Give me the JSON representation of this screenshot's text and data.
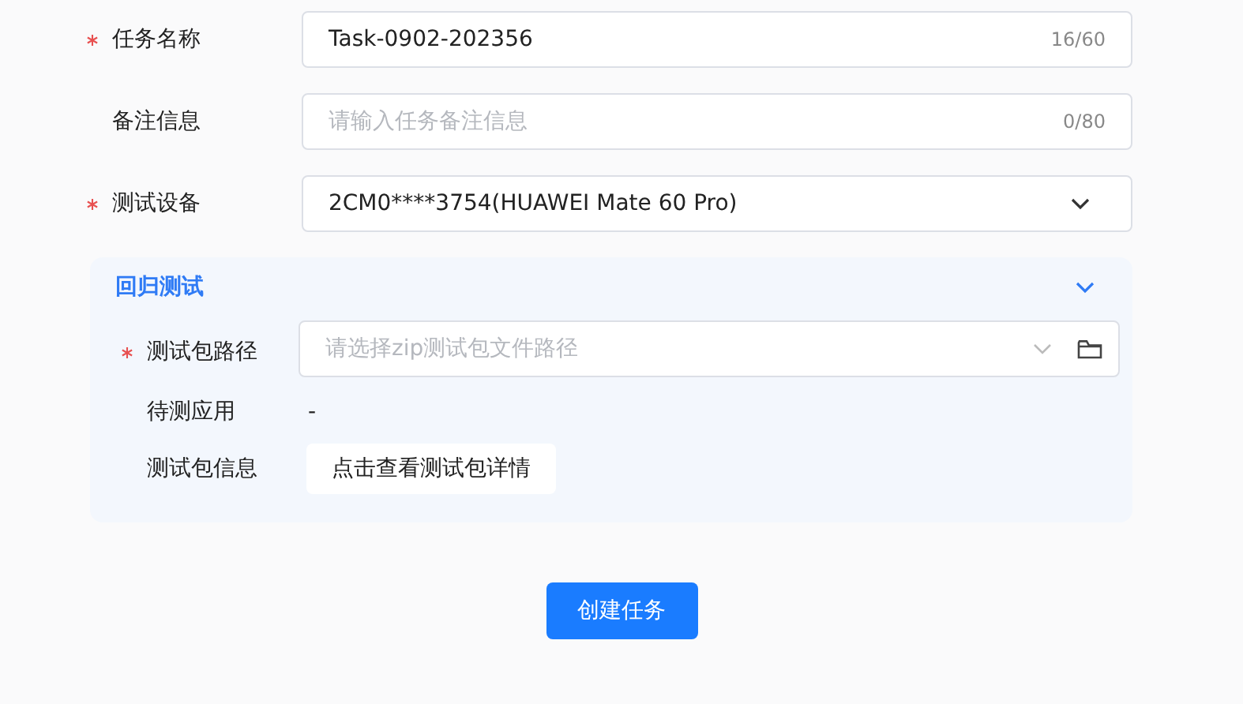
{
  "fields": [
    {
      "kind": "text",
      "label": "任务名称",
      "required": true,
      "value": "Task-0902-202356",
      "counter": "16/60"
    },
    {
      "kind": "text",
      "label": "备注信息",
      "required": false,
      "placeholder": "请输入任务备注信息",
      "counter": "0/80"
    },
    {
      "kind": "select",
      "label": "测试设备",
      "required": true,
      "value": "2CM0****3754(HUAWEI Mate 60 Pro)"
    }
  ],
  "section": {
    "title": "回归测试",
    "expanded": true,
    "rows": [
      {
        "kind": "path",
        "label": "测试包路径",
        "required": true,
        "placeholder": "请选择zip测试包文件路径"
      },
      {
        "kind": "value",
        "label": "待测应用",
        "required": false,
        "value": "-"
      },
      {
        "kind": "button",
        "label": "测试包信息",
        "required": false,
        "button": "点击查看测试包详情"
      }
    ]
  },
  "submit": "创建任务"
}
